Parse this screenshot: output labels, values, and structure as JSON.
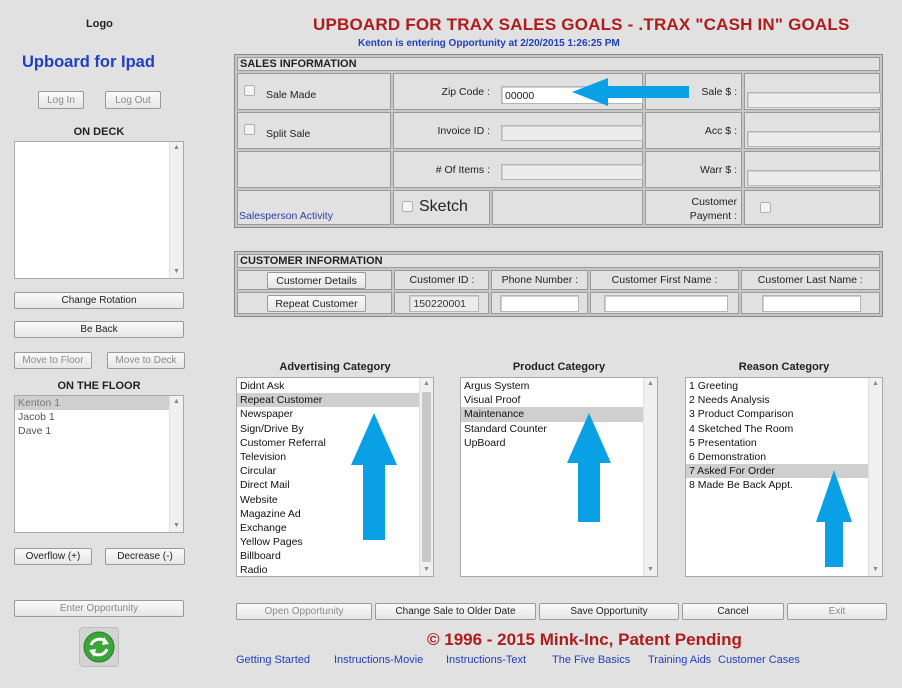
{
  "header": {
    "logo": "Logo",
    "title": "UPBOARD FOR TRAX SALES GOALS - .TRAX \"CASH IN\" GOALS",
    "subtitle": "Kenton is entering Opportunity at 2/20/2015 1:26:25 PM"
  },
  "sidebar": {
    "app_name": "Upboard for Ipad",
    "login": "Log In",
    "logout": "Log Out",
    "on_deck_title": "ON DECK",
    "change_rotation": "Change Rotation",
    "be_back": "Be Back",
    "move_to_floor": "Move to Floor",
    "move_to_deck": "Move to Deck",
    "on_floor_title": "ON THE FLOOR",
    "on_floor": [
      "Kenton 1",
      "Jacob 1",
      "Dave 1"
    ],
    "overflow": "Overflow (+)",
    "decrease": "Decrease (-)",
    "enter_opportunity": "Enter Opportunity"
  },
  "sales": {
    "title": "SALES INFORMATION",
    "sale_made": "Sale Made",
    "split_sale": "Split Sale",
    "zip_label": "Zip Code :",
    "zip_value": "00000",
    "invoice_label": "Invoice ID :",
    "items_label": "# Of Items :",
    "sale_label": "Sale $ :",
    "acc_label": "Acc $ :",
    "warr_label": "Warr $ :",
    "salesperson_activity": "Salesperson Activity",
    "sketch": "Sketch",
    "customer_payment_1": "Customer",
    "customer_payment_2": "Payment :"
  },
  "customer": {
    "title": "CUSTOMER INFORMATION",
    "details_button": "Customer Details",
    "repeat_button": "Repeat Customer",
    "id_label": "Customer ID :",
    "id_value": "150220001",
    "phone_label": "Phone Number :",
    "first_label": "Customer First Name :",
    "last_label": "Customer Last Name :"
  },
  "advertising": {
    "title": "Advertising Category",
    "items": [
      "Didnt Ask",
      "Repeat Customer",
      "Newspaper",
      "Sign/Drive By",
      "Customer Referral",
      "Television",
      "Circular",
      "Direct Mail",
      "Website",
      "Magazine Ad",
      "Exchange",
      "Yellow Pages",
      "Billboard",
      "Radio"
    ],
    "selected": 1
  },
  "product": {
    "title": "Product Category",
    "items": [
      "Argus System",
      "Visual Proof",
      "Maintenance",
      "Standard Counter",
      "UpBoard"
    ],
    "selected": 2
  },
  "reason": {
    "title": "Reason Category",
    "items": [
      "1 Greeting",
      "2 Needs Analysis",
      "3 Product Comparison",
      "4 Sketched The Room",
      "5 Presentation",
      "6 Demonstration",
      "7 Asked For Order",
      "8 Made Be Back Appt."
    ],
    "selected": 6
  },
  "actions": {
    "open": "Open Opportunity",
    "change": "Change  Sale to Older Date",
    "save": "Save Opportunity",
    "cancel": "Cancel",
    "exit": "Exit"
  },
  "footer": {
    "copyright": "© 1996 - 2015 Mink-Inc, Patent Pending",
    "links": [
      "Getting Started",
      "Instructions-Movie",
      "Instructions-Text",
      "The Five Basics",
      "Training Aids",
      "Customer Cases"
    ]
  },
  "colors": {
    "title_red": "#b01c1c",
    "link_blue": "#1f3fc4",
    "arrow_blue": "#0aa0e6"
  },
  "icons": [
    "refresh-icon",
    "arrow-up-icon",
    "arrow-left-icon"
  ]
}
